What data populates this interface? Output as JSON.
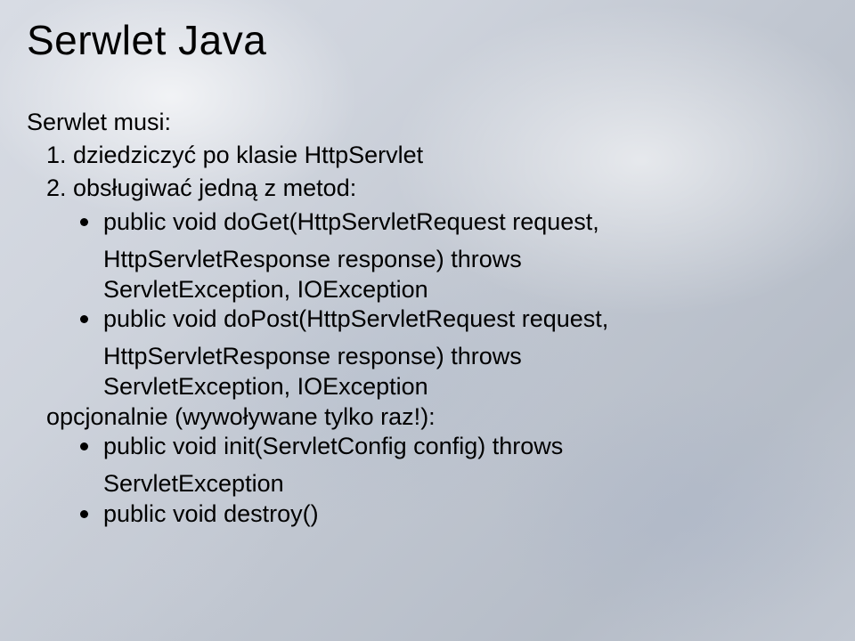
{
  "title": "Serwlet Java",
  "intro": "Serwlet musi:",
  "item1": "1. dziedziczyć po klasie  HttpServlet",
  "item2": "2. obsługiwać jedną z metod:",
  "bullet1a": "public void doGet(HttpServletRequest request,",
  "bullet1b": "HttpServletResponse response) throws",
  "bullet1c": "ServletException, IOException",
  "bullet2a": "public void doPost(HttpServletRequest request,",
  "bullet2b": "HttpServletResponse response) throws",
  "bullet2c": "ServletException, IOException",
  "optional": "opcjonalnie (wywoływane tylko raz!):",
  "bullet3a": "public void init(ServletConfig config) throws",
  "bullet3b": "ServletException",
  "bullet4": "public void destroy()"
}
